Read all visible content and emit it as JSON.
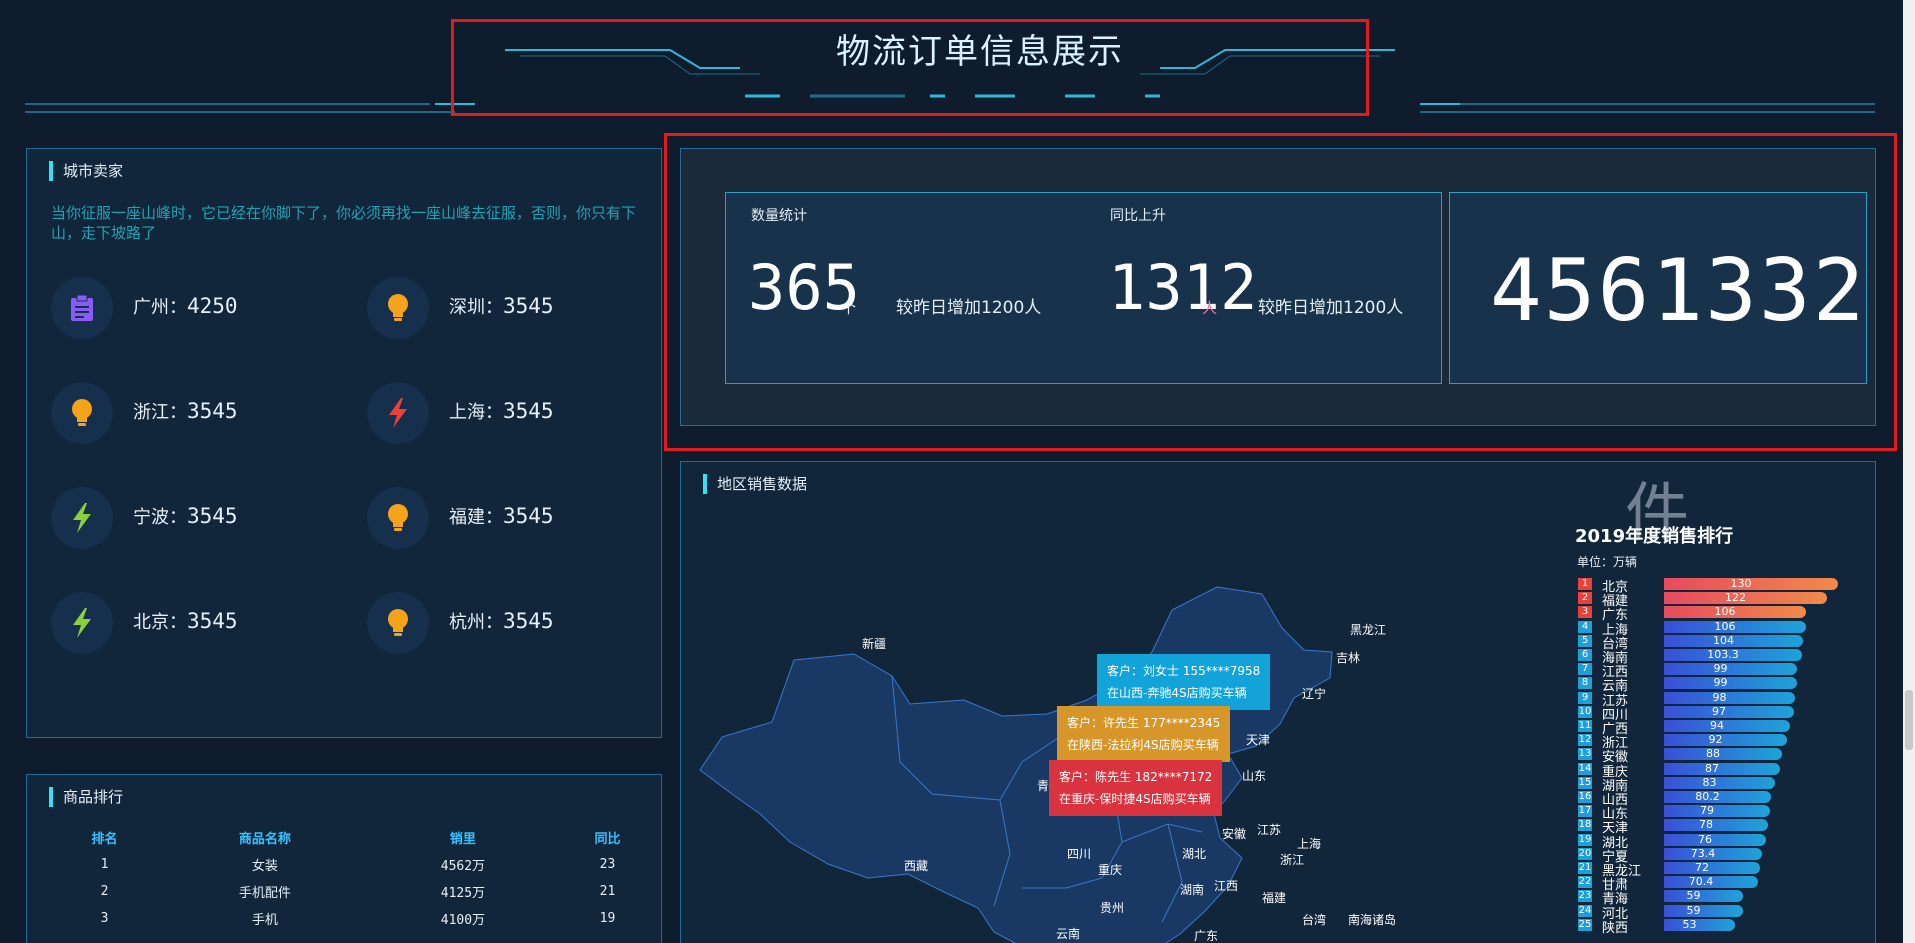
{
  "header": {
    "title": "物流订单信息展示"
  },
  "city_panel": {
    "title": "城市卖家",
    "quote": "当你征服一座山峰时，它已经在你脚下了，你必须再找一座山峰去征服，否则，你只有下山，走下坡路了",
    "cities": [
      {
        "name": "广州：",
        "value": "4250",
        "icon": "clipboard-icon",
        "color": "#8a5cf6"
      },
      {
        "name": "深圳：",
        "value": "3545",
        "icon": "lightbulb-icon",
        "color": "#f5a31a"
      },
      {
        "name": "浙江：",
        "value": "3545",
        "icon": "lightbulb-icon",
        "color": "#f5a31a"
      },
      {
        "name": "上海：",
        "value": "3545",
        "icon": "lightning-icon",
        "color": "#e8423a"
      },
      {
        "name": "宁波：",
        "value": "3545",
        "icon": "lightning-icon",
        "color": "#8ccf3c"
      },
      {
        "name": "福建：",
        "value": "3545",
        "icon": "lightbulb-icon",
        "color": "#f5a31a"
      },
      {
        "name": "北京：",
        "value": "3545",
        "icon": "lightning-icon",
        "color": "#8ccf3c"
      },
      {
        "name": "杭州：",
        "value": "3545",
        "icon": "lightbulb-icon",
        "color": "#f5a31a"
      }
    ]
  },
  "product_panel": {
    "title": "商品排行",
    "headers": [
      "排名",
      "商品名称",
      "销里",
      "同比"
    ],
    "rows": [
      [
        "1",
        "女装",
        "4562万",
        "23"
      ],
      [
        "2",
        "手机配件",
        "4125万",
        "21"
      ],
      [
        "3",
        "手机",
        "4100万",
        "19"
      ]
    ]
  },
  "stats": {
    "count_label": "数量统计",
    "count_value": "365",
    "count_unit": "个",
    "count_compare": "较昨日增加1200人",
    "yoy_label": "同比上升",
    "yoy_value": "1312",
    "yoy_unit": "人",
    "yoy_compare": "较昨日增加1200人",
    "total_value": "4561332"
  },
  "map_panel": {
    "title": "地区销售数据",
    "provinces": [
      "新疆",
      "西藏",
      "青海",
      "四川",
      "重庆",
      "贵州",
      "云南",
      "湖北",
      "湖南",
      "江西",
      "广东",
      "福建",
      "台湾",
      "南海诸岛",
      "安徽",
      "江苏",
      "上海",
      "浙江",
      "山东",
      "天津",
      "辽宁",
      "吉林",
      "黑龙江"
    ],
    "tooltips": [
      {
        "line1": "客户：刘女士  155****7958",
        "line2": "在山西-奔驰4S店购买车辆",
        "color": "#12a3d8"
      },
      {
        "line1": "客户：许先生  177****2345",
        "line2": "在陕西-法拉利4S店购买车辆",
        "color": "#d7962a"
      },
      {
        "line1": "客户：陈先生  182****7172",
        "line2": "在重庆-保时捷4S店购买车辆",
        "color": "#d9333f"
      }
    ]
  },
  "sales_ranking": {
    "bg_char": "件",
    "title": "2019年度销售排行",
    "unit": "单位：万辆",
    "items": [
      {
        "rank": "1",
        "name": "北京",
        "value": 130
      },
      {
        "rank": "2",
        "name": "福建",
        "value": 122
      },
      {
        "rank": "3",
        "name": "广东",
        "value": 106
      },
      {
        "rank": "4",
        "name": "上海",
        "value": 106
      },
      {
        "rank": "5",
        "name": "台湾",
        "value": 104
      },
      {
        "rank": "6",
        "name": "海南",
        "value": 103.3
      },
      {
        "rank": "7",
        "name": "江西",
        "value": 99
      },
      {
        "rank": "8",
        "name": "云南",
        "value": 99
      },
      {
        "rank": "9",
        "name": "江苏",
        "value": 98
      },
      {
        "rank": "10",
        "name": "四川",
        "value": 97
      },
      {
        "rank": "11",
        "name": "广西",
        "value": 94
      },
      {
        "rank": "12",
        "name": "浙江",
        "value": 92
      },
      {
        "rank": "13",
        "name": "安徽",
        "value": 88
      },
      {
        "rank": "14",
        "name": "重庆",
        "value": 87
      },
      {
        "rank": "15",
        "name": "湖南",
        "value": 83
      },
      {
        "rank": "16",
        "name": "山西",
        "value": 80.2
      },
      {
        "rank": "17",
        "name": "山东",
        "value": 79
      },
      {
        "rank": "18",
        "name": "天津",
        "value": 78
      },
      {
        "rank": "19",
        "name": "湖北",
        "value": 76
      },
      {
        "rank": "20",
        "name": "宁夏",
        "value": 73.4
      },
      {
        "rank": "21",
        "name": "黑龙江",
        "value": 72
      },
      {
        "rank": "22",
        "name": "甘肃",
        "value": 70.4
      },
      {
        "rank": "23",
        "name": "青海",
        "value": 59
      },
      {
        "rank": "24",
        "name": "河北",
        "value": 59
      },
      {
        "rank": "25",
        "name": "陕西",
        "value": 53
      }
    ],
    "max": 130
  }
}
